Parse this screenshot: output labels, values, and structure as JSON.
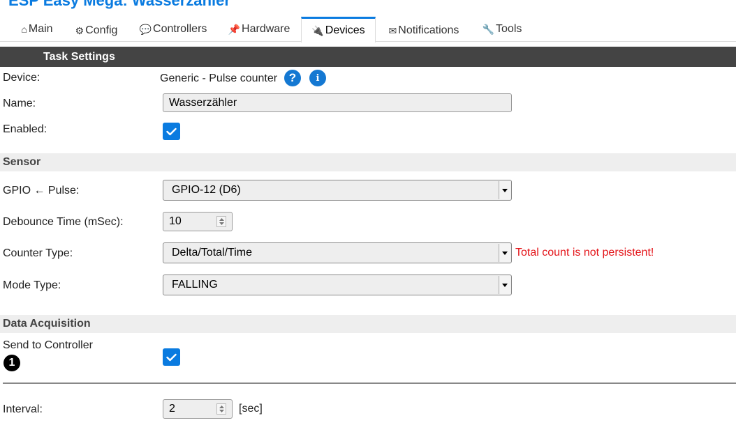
{
  "header": {
    "title": "ESP Easy Mega: Wasserzähler"
  },
  "tabs": [
    {
      "label": "Main",
      "icon": "⌂"
    },
    {
      "label": "Config",
      "icon": "⚙"
    },
    {
      "label": "Controllers",
      "icon": "💬"
    },
    {
      "label": "Hardware",
      "icon": "📌"
    },
    {
      "label": "Devices",
      "icon": "🔌"
    },
    {
      "label": "Notifications",
      "icon": "✉"
    },
    {
      "label": "Tools",
      "icon": "🔧"
    }
  ],
  "task_settings": {
    "title": "Task Settings",
    "device_label": "Device:",
    "device_value": "Generic - Pulse counter",
    "help_symbol": "?",
    "info_symbol": "i",
    "name_label": "Name:",
    "name_value": "Wasserzähler",
    "enabled_label": "Enabled:"
  },
  "sensor": {
    "title": "Sensor",
    "gpio_label": "GPIO ← Pulse:",
    "gpio_value": "GPIO-12 (D6)",
    "debounce_label": "Debounce Time (mSec):",
    "debounce_value": "10",
    "counter_type_label": "Counter Type:",
    "counter_type_value": "Delta/Total/Time",
    "counter_warning": "Total count is not persistent!",
    "mode_type_label": "Mode Type:",
    "mode_type_value": "FALLING"
  },
  "data_acquisition": {
    "title": "Data Acquisition",
    "send_label": "Send to Controller",
    "controller_badge": "1",
    "interval_label": "Interval:",
    "interval_value": "2",
    "interval_unit": "[sec]"
  },
  "colors": {
    "accent": "#0a7be0",
    "header_bar": "#444444",
    "warning": "#e4161b"
  }
}
